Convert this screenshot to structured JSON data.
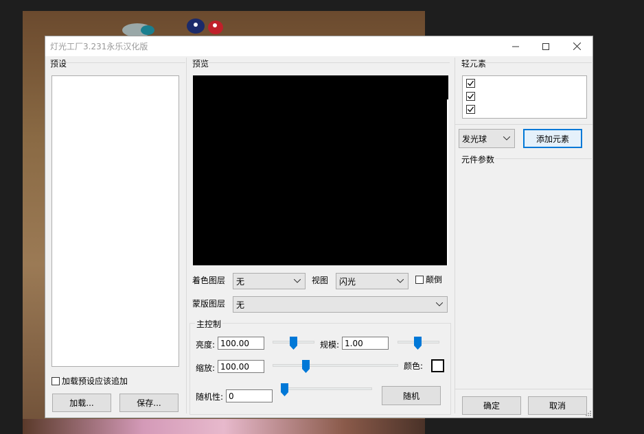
{
  "window": {
    "title": "灯光工厂3.231永乐汉化版"
  },
  "presets": {
    "group_label": "预设",
    "append_checkbox": {
      "label": "加载预设应该追加",
      "checked": false
    },
    "load_button": "加载...",
    "save_button": "保存..."
  },
  "preview": {
    "group_label": "预览",
    "color_layer": {
      "label": "着色图层",
      "value": "无"
    },
    "view": {
      "label": "视图",
      "value": "闪光"
    },
    "invert": {
      "label": "颠倒",
      "checked": false
    },
    "mask_layer": {
      "label": "蒙版图层",
      "value": "无"
    }
  },
  "main_control": {
    "group_label": "主控制",
    "brightness": {
      "label": "亮度:",
      "value": "100.00",
      "level": 0.5
    },
    "scale": {
      "label": "规模:",
      "value": "1.00",
      "level": 0.5
    },
    "zoom": {
      "label": "缩放:",
      "value": "100.00",
      "level": 0.25
    },
    "color": {
      "label": "颜色:",
      "swatch": "#ffffff"
    },
    "randomness": {
      "label": "随机性:",
      "value": "0",
      "level": 0
    },
    "random_button": "随机"
  },
  "elements": {
    "group_label": "轻元素",
    "list": [
      {
        "checked": true
      },
      {
        "checked": true
      },
      {
        "checked": true
      }
    ],
    "type_select": "发光球",
    "add_button": "添加元素",
    "params_label": "元件参数"
  },
  "footer": {
    "ok_button": "确定",
    "cancel_button": "取消"
  },
  "colors": {
    "accent": "#0078d7",
    "preview_bg": "#000000"
  }
}
